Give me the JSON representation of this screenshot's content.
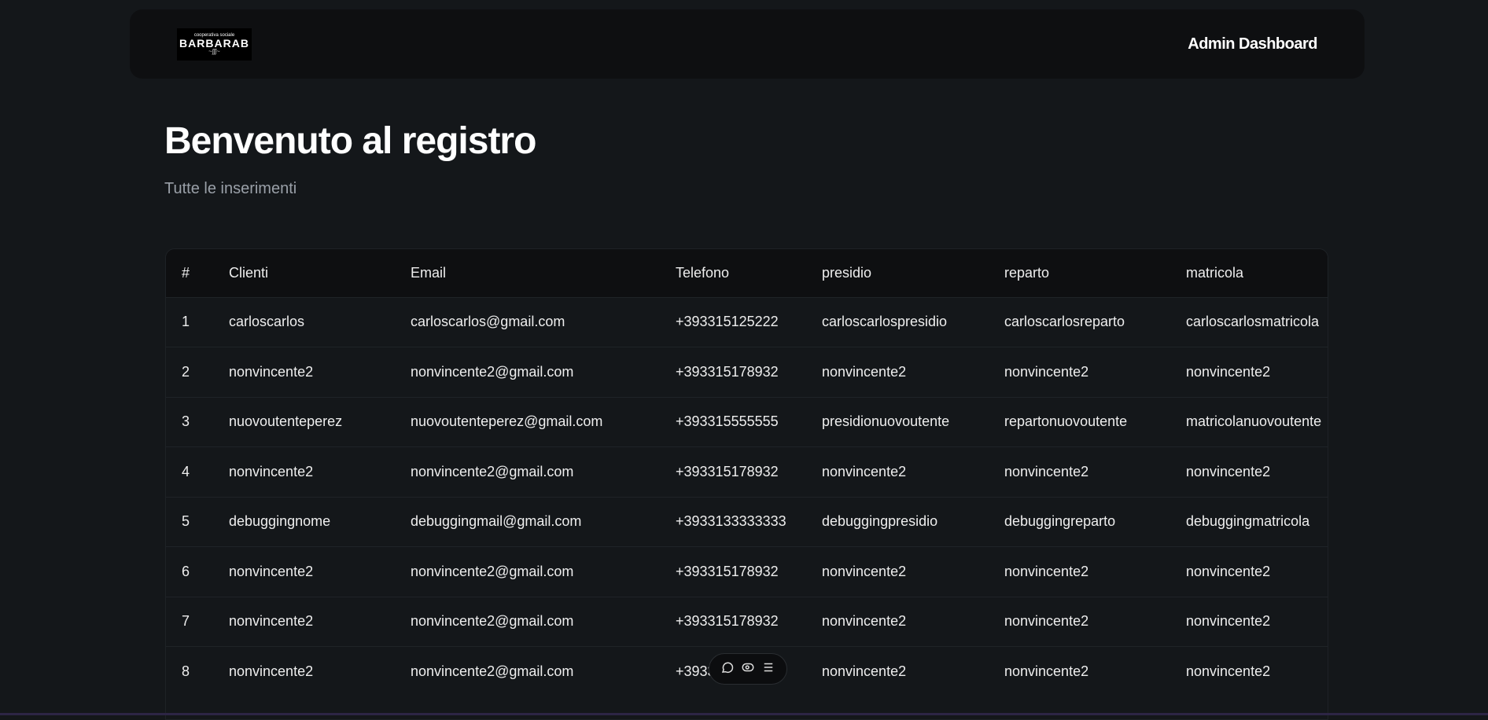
{
  "header": {
    "logo_top": "cooperativa sociale",
    "logo_name": "BARBARAB",
    "logo_sign": "~ʃʃʃ~",
    "admin_link": "Admin Dashboard"
  },
  "page": {
    "title": "Benvenuto al registro",
    "subtitle": "Tutte le inserimenti"
  },
  "table": {
    "columns": [
      "#",
      "Clienti",
      "Email",
      "Telefono",
      "presidio",
      "reparto",
      "matricola"
    ],
    "rows": [
      [
        "1",
        "carloscarlos",
        "carloscarlos@gmail.com",
        "+393315125222",
        "carloscarlospresidio",
        "carloscarlosreparto",
        "carloscarlosmatricola"
      ],
      [
        "2",
        "nonvincente2",
        "nonvincente2@gmail.com",
        "+393315178932",
        "nonvincente2",
        "nonvincente2",
        "nonvincente2"
      ],
      [
        "3",
        "nuovoutenteperez",
        "nuovoutenteperez@gmail.com",
        "+393315555555",
        "presidionuovoutente",
        "repartonuovoutente",
        "matricolanuovoutente"
      ],
      [
        "4",
        "nonvincente2",
        "nonvincente2@gmail.com",
        "+393315178932",
        "nonvincente2",
        "nonvincente2",
        "nonvincente2"
      ],
      [
        "5",
        "debuggingnome",
        "debuggingmail@gmail.com",
        "+3933133333333",
        "debuggingpresidio",
        "debuggingreparto",
        "debuggingmatricola"
      ],
      [
        "6",
        "nonvincente2",
        "nonvincente2@gmail.com",
        "+393315178932",
        "nonvincente2",
        "nonvincente2",
        "nonvincente2"
      ],
      [
        "7",
        "nonvincente2",
        "nonvincente2@gmail.com",
        "+393315178932",
        "nonvincente2",
        "nonvincente2",
        "nonvincente2"
      ],
      [
        "8",
        "nonvincente2",
        "nonvincente2@gmail.com",
        "+393315178932",
        "nonvincente2",
        "nonvincente2",
        "nonvincente2"
      ]
    ]
  },
  "toolbar": {
    "icons": [
      "comment-icon",
      "eye-icon",
      "menu-icon"
    ]
  }
}
